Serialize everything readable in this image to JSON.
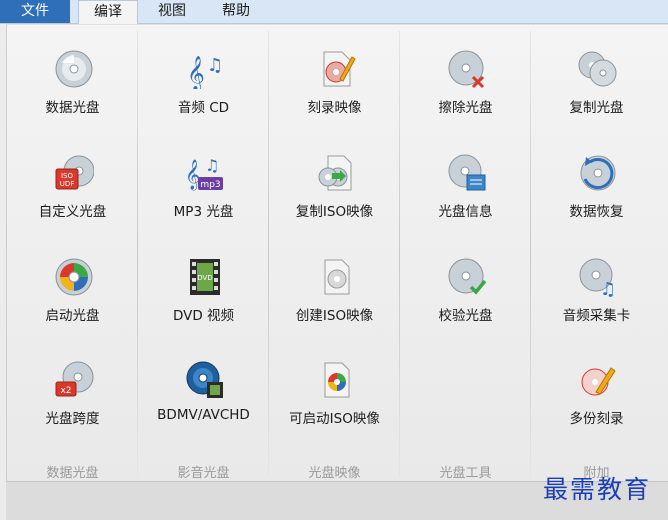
{
  "menu": {
    "file": "文件",
    "edit": "编译",
    "view": "视图",
    "help": "帮助"
  },
  "groups": [
    {
      "title": "数据光盘",
      "items": [
        {
          "label": "数据光盘",
          "icon": "disc-icon"
        },
        {
          "label": "自定义光盘",
          "icon": "iso-udf-disc-icon"
        },
        {
          "label": "启动光盘",
          "icon": "boot-disc-icon"
        },
        {
          "label": "光盘跨度",
          "icon": "disc-span-x2-icon"
        }
      ]
    },
    {
      "title": "影音光盘",
      "items": [
        {
          "label": "音频 CD",
          "icon": "music-notes-icon"
        },
        {
          "label": "MP3 光盘",
          "icon": "mp3-icon"
        },
        {
          "label": "DVD 视频",
          "icon": "dvd-film-icon"
        },
        {
          "label": "BDMV/AVCHD",
          "icon": "bluray-disc-icon"
        }
      ]
    },
    {
      "title": "光盘映像",
      "items": [
        {
          "label": "刻录映像",
          "icon": "burn-image-icon"
        },
        {
          "label": "复制ISO映像",
          "icon": "copy-iso-icon"
        },
        {
          "label": "创建ISO映像",
          "icon": "create-iso-icon"
        },
        {
          "label": "可启动ISO映像",
          "icon": "bootable-iso-icon"
        }
      ]
    },
    {
      "title": "光盘工具",
      "items": [
        {
          "label": "擦除光盘",
          "icon": "erase-disc-icon"
        },
        {
          "label": "光盘信息",
          "icon": "disc-info-icon"
        },
        {
          "label": "校验光盘",
          "icon": "verify-disc-icon"
        }
      ]
    },
    {
      "title": "附加",
      "items": [
        {
          "label": "复制光盘",
          "icon": "copy-disc-icon"
        },
        {
          "label": "数据恢复",
          "icon": "data-recovery-icon"
        },
        {
          "label": "音频采集卡",
          "icon": "audio-grabber-icon"
        },
        {
          "label": "多份刻录",
          "icon": "multi-burn-icon"
        }
      ]
    }
  ],
  "watermark": "最需教育",
  "colors": {
    "accent": "#2f6fba",
    "disc": "#c9d1d8",
    "red": "#d8392b",
    "green": "#3aa845",
    "purple": "#6b3fa0"
  }
}
